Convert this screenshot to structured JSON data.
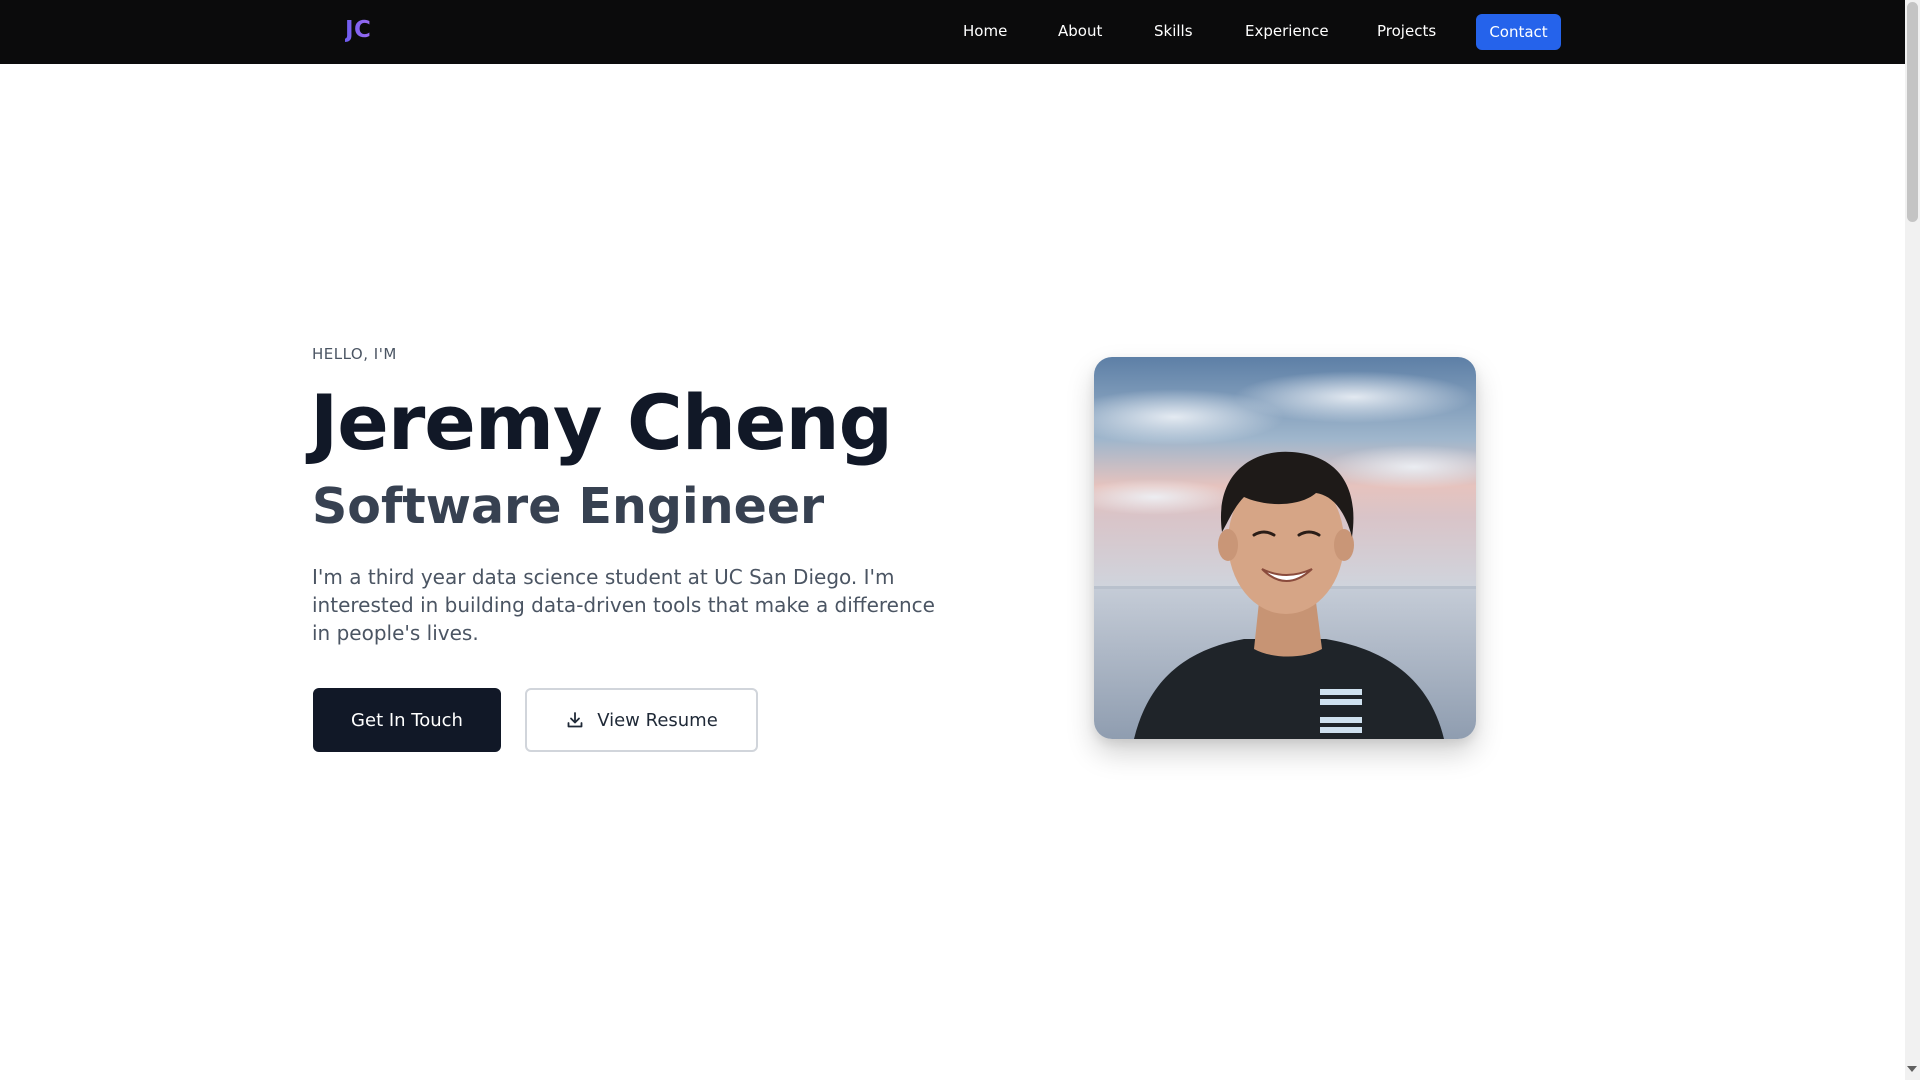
{
  "nav": {
    "logo": "JC",
    "links": [
      "Home",
      "About",
      "Skills",
      "Experience",
      "Projects"
    ],
    "contact": "Contact"
  },
  "hero": {
    "greeting": "HELLO, I'M",
    "name": "Jeremy Cheng",
    "role": "Software Engineer",
    "bio": "I'm a third year data science student at UC San Diego. I'm interested in building data-driven tools that make a difference in people's lives.",
    "primary_button": "Get In Touch",
    "secondary_button": "View Resume",
    "secondary_icon": "download-icon",
    "photo": "profile-photo"
  },
  "colors": {
    "nav_bg": "#0b0b0c",
    "accent": "#2563eb",
    "logo_gradient": [
      "#6d5cf0",
      "#9b6bf2"
    ],
    "primary_button_bg": "#111827",
    "heading": "#111827",
    "subheading": "#374151",
    "body_text": "#4b5563"
  }
}
